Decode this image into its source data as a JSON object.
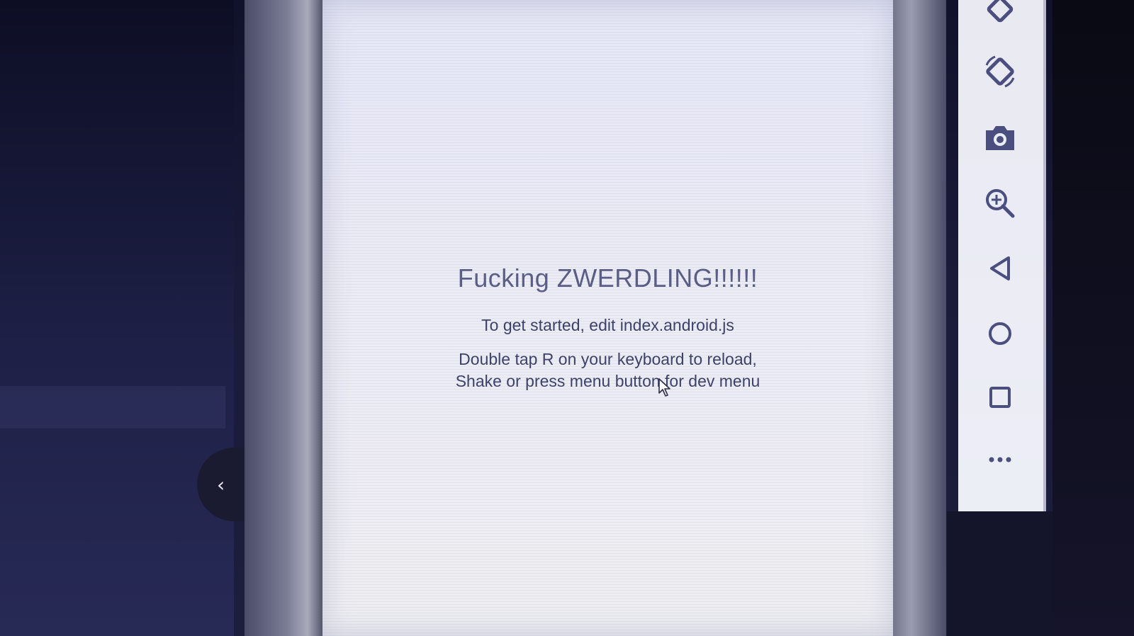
{
  "app": {
    "welcome_title": "Fucking ZWERDLING!!!!!!",
    "instructions_edit": "To get started, edit index.android.js",
    "instructions_reload_line1": "Double tap R on your keyboard to reload,",
    "instructions_reload_line2": "Shake or press menu button for dev menu"
  },
  "emulator_toolbar": {
    "buttons": [
      {
        "icon": "rotate-right-icon"
      },
      {
        "icon": "rotate-left-icon"
      },
      {
        "icon": "camera-icon"
      },
      {
        "icon": "zoom-in-icon"
      },
      {
        "icon": "back-triangle-icon"
      },
      {
        "icon": "home-circle-icon"
      },
      {
        "icon": "overview-square-icon"
      },
      {
        "icon": "more-dots-icon"
      }
    ]
  },
  "sidebar": {
    "collapse_glyph": "‹"
  },
  "colors": {
    "screen_bg": "#ececf4",
    "title_text": "#5a5d86",
    "body_text": "#3e4168",
    "toolbar_bg": "#eceef6",
    "icon": "#4b4f80"
  }
}
